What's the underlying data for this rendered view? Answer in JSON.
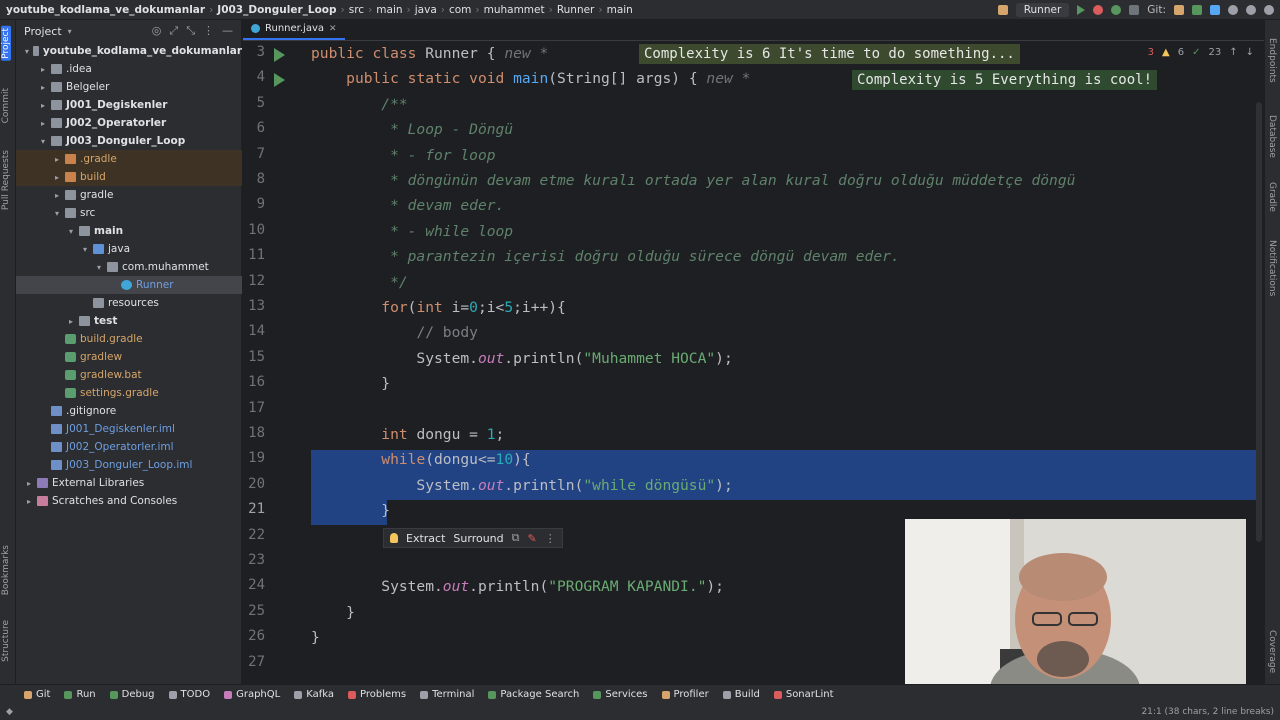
{
  "breadcrumbs": [
    "youtube_kodlama_ve_dokumanlar",
    "J003_Donguler_Loop",
    "src",
    "main",
    "java",
    "com",
    "muhammet",
    "Runner",
    "main"
  ],
  "toolbar": {
    "run_config": "Runner",
    "git_label": "Git:"
  },
  "left_tabs": [
    "Project",
    "Commit",
    "Pull Requests",
    "Bookmarks",
    "Structure"
  ],
  "right_tabs": [
    "Endpoints",
    "Database",
    "Gradle",
    "Notifications",
    "Coverage"
  ],
  "project": {
    "title": "Project",
    "tree": [
      {
        "label": "youtube_kodlama_ve_dokumanlar",
        "indent": 1,
        "arrow": "▾",
        "icon": "folder",
        "style": "txt-bold"
      },
      {
        "label": ".idea",
        "indent": 2,
        "arrow": "▸",
        "icon": "folder",
        "style": ""
      },
      {
        "label": "Belgeler",
        "indent": 2,
        "arrow": "▸",
        "icon": "folder",
        "style": ""
      },
      {
        "label": "J001_Degiskenler",
        "indent": 2,
        "arrow": "▸",
        "icon": "folder",
        "style": "txt-bold"
      },
      {
        "label": "J002_Operatorler",
        "indent": 2,
        "arrow": "▸",
        "icon": "folder",
        "style": "txt-bold"
      },
      {
        "label": "J003_Donguler_Loop",
        "indent": 2,
        "arrow": "▾",
        "icon": "folder",
        "style": "txt-bold"
      },
      {
        "label": ".gradle",
        "indent": 3,
        "arrow": "▸",
        "icon": "folder-orange",
        "style": "txt-orange",
        "excluded": true
      },
      {
        "label": "build",
        "indent": 3,
        "arrow": "▸",
        "icon": "folder-orange",
        "style": "txt-orange",
        "excluded": true
      },
      {
        "label": "gradle",
        "indent": 3,
        "arrow": "▸",
        "icon": "folder",
        "style": ""
      },
      {
        "label": "src",
        "indent": 3,
        "arrow": "▾",
        "icon": "folder",
        "style": ""
      },
      {
        "label": "main",
        "indent": 4,
        "arrow": "▾",
        "icon": "folder",
        "style": "txt-bold"
      },
      {
        "label": "java",
        "indent": 5,
        "arrow": "▾",
        "icon": "folder-blue",
        "style": ""
      },
      {
        "label": "com.muhammet",
        "indent": 6,
        "arrow": "▾",
        "icon": "folder",
        "style": ""
      },
      {
        "label": "Runner",
        "indent": 7,
        "arrow": "",
        "icon": "file-c",
        "style": "txt-blue",
        "selected": true
      },
      {
        "label": "resources",
        "indent": 5,
        "arrow": "",
        "icon": "folder",
        "style": ""
      },
      {
        "label": "test",
        "indent": 4,
        "arrow": "▸",
        "icon": "folder",
        "style": "txt-bold"
      },
      {
        "label": "build.gradle",
        "indent": 3,
        "arrow": "",
        "icon": "file-g",
        "style": "txt-orange"
      },
      {
        "label": "gradlew",
        "indent": 3,
        "arrow": "",
        "icon": "file-g",
        "style": "txt-orange"
      },
      {
        "label": "gradlew.bat",
        "indent": 3,
        "arrow": "",
        "icon": "file-g",
        "style": "txt-orange"
      },
      {
        "label": "settings.gradle",
        "indent": 3,
        "arrow": "",
        "icon": "file-g",
        "style": "txt-orange"
      },
      {
        "label": ".gitignore",
        "indent": 2,
        "arrow": "",
        "icon": "iml",
        "style": ""
      },
      {
        "label": "J001_Degiskenler.iml",
        "indent": 2,
        "arrow": "",
        "icon": "iml",
        "style": "txt-blue"
      },
      {
        "label": "J002_Operatorler.iml",
        "indent": 2,
        "arrow": "",
        "icon": "iml",
        "style": "txt-blue"
      },
      {
        "label": "J003_Donguler_Loop.iml",
        "indent": 2,
        "arrow": "",
        "icon": "iml",
        "style": "txt-blue"
      },
      {
        "label": "External Libraries",
        "indent": 1,
        "arrow": "▸",
        "icon": "lib",
        "style": ""
      },
      {
        "label": "Scratches and Consoles",
        "indent": 1,
        "arrow": "▸",
        "icon": "scr",
        "style": ""
      }
    ]
  },
  "editor": {
    "tab": "Runner.java",
    "complexity_1": "Complexity is 6 It's time to do something...",
    "complexity_2": "Complexity is 5 Everything is cool!",
    "inspections": {
      "errors": "3",
      "warnings": "6",
      "typos": "23"
    },
    "popup": {
      "extract": "Extract",
      "surround": "Surround"
    },
    "lines": [
      {
        "n": "3",
        "html": "<span class='kw'>public class</span> Runner { <span class='hint'>new *</span>"
      },
      {
        "n": "4",
        "html": "    <span class='kw'>public static void</span> <span class='fn'>main</span>(String[] args) { <span class='hint'>new *</span>"
      },
      {
        "n": "5",
        "html": "        <span class='doc'>/**</span>"
      },
      {
        "n": "6",
        "html": "         <span class='doc'>* Loop - Döngü</span>"
      },
      {
        "n": "7",
        "html": "         <span class='doc'>* - for loop</span>"
      },
      {
        "n": "8",
        "html": "         <span class='doc'>* döngünün devam etme kuralı ortada yer alan kural doğru olduğu müddetçe döngü</span>"
      },
      {
        "n": "9",
        "html": "         <span class='doc'>* devam eder.</span>"
      },
      {
        "n": "10",
        "html": "         <span class='doc'>* - while loop</span>"
      },
      {
        "n": "11",
        "html": "         <span class='doc'>* parantezin içerisi doğru olduğu sürece döngü devam eder.</span>"
      },
      {
        "n": "12",
        "html": "         <span class='doc'>*/</span>"
      },
      {
        "n": "13",
        "html": "        <span class='kw'>for</span>(<span class='kw'>int</span> i=<span class='num'>0</span>;i&lt;<span class='num'>5</span>;i++){"
      },
      {
        "n": "14",
        "html": "            <span class='cmt'>// body</span>"
      },
      {
        "n": "15",
        "html": "            System.<span class='field'>out</span>.println(<span class='str'>\"Muhammet HOCA\"</span>);"
      },
      {
        "n": "16",
        "html": "        }"
      },
      {
        "n": "17",
        "html": ""
      },
      {
        "n": "18",
        "html": "        <span class='kw'>int</span> dongu = <span class='num'>1</span>;"
      },
      {
        "n": "19",
        "html": "        <span class='kw'>while</span>(dongu&lt;=<span class='num'>10</span>){"
      },
      {
        "n": "20",
        "html": "            System.<span class='field'>out</span>.println(<span class='str'>\"while döngüsü\"</span>);"
      },
      {
        "n": "21",
        "html": "        }"
      },
      {
        "n": "22",
        "html": ""
      },
      {
        "n": "23",
        "html": ""
      },
      {
        "n": "24",
        "html": "        System.<span class='field'>out</span>.println(<span class='str'>\"PROGRAM KAPANDI.\"</span>);"
      },
      {
        "n": "25",
        "html": "    }"
      },
      {
        "n": "26",
        "html": "}"
      },
      {
        "n": "27",
        "html": ""
      }
    ]
  },
  "bottom_tools": [
    "Git",
    "Run",
    "Debug",
    "TODO",
    "GraphQL",
    "Kafka",
    "Problems",
    "Terminal",
    "Package Search",
    "Services",
    "Profiler",
    "Build",
    "SonarLint"
  ],
  "status": {
    "position": "21:1 (38 chars, 2 line breaks)"
  }
}
